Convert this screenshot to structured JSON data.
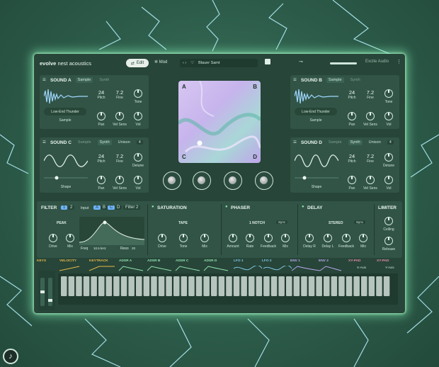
{
  "header": {
    "brand_bold": "evolve",
    "brand_rest": " nest acoustics",
    "edit_label": "Edit",
    "mod_label": "Mod",
    "preset_nav": "‹ ›",
    "preset_name": "Blauer Samt",
    "output_label": "Excite Audio",
    "menu": "⋮"
  },
  "sound_a": {
    "title": "SOUND A",
    "tab1": "Sample",
    "tab2": "Synth",
    "sample_name": "Low-End Thunder",
    "sample_label": "Sample",
    "pitch_val": "24",
    "pitch_label": "Pitch",
    "fine_val": "7.2",
    "fine_label": "Fine",
    "tone_label": "Tone",
    "pan_label": "Pan",
    "velsens_label": "Vel Sens",
    "vol_label": "Vol"
  },
  "sound_b": {
    "title": "SOUND B",
    "tab1": "Sample",
    "tab2": "Synth",
    "sample_name": "Low-End Thunder",
    "sample_label": "Sample",
    "pitch_val": "24",
    "pitch_label": "Pitch",
    "fine_val": "7.2",
    "fine_label": "Fine",
    "tone_label": "Tone",
    "pan_label": "Pan",
    "velsens_label": "Vel Sens",
    "vol_label": "Vol"
  },
  "sound_c": {
    "title": "SOUND C",
    "tab1": "Sample",
    "tab2": "Synth",
    "unison_label": "Unison",
    "unison_val": "4",
    "shape_label": "Shape",
    "pitch_val": "24",
    "pitch_label": "Pitch",
    "fine_val": "7.2",
    "fine_label": "Fine",
    "detune_label": "Detune",
    "pan_label": "Pan",
    "velsens_label": "Vel Sens",
    "vol_label": "Vol"
  },
  "sound_d": {
    "title": "SOUND D",
    "tab1": "Sample",
    "tab2": "Synth",
    "unison_label": "Unison",
    "unison_val": "4",
    "shape_label": "Shape",
    "pitch_val": "24",
    "pitch_label": "Pitch",
    "fine_val": "7.2",
    "fine_label": "Fine",
    "detune_label": "Detune",
    "pan_label": "Pan",
    "velsens_label": "Vel Sens",
    "vol_label": "Vol"
  },
  "xy_pad": {
    "a": "A",
    "b": "B",
    "c": "C",
    "d": "D"
  },
  "fx": {
    "filter": {
      "title": "FILTER",
      "btn1": "1",
      "btn2": "2",
      "input_label": "Input",
      "in_a": "A",
      "in_b": "B",
      "in_c": "C",
      "in_d": "D",
      "filter2": "Filter 2",
      "mode": "PEAK",
      "drive": "Drive",
      "mix": "Mix",
      "freq": "Freq",
      "freq_val": "10.5 kHz",
      "reso": "Reso",
      "reso_val": "20"
    },
    "saturation": {
      "title": "SATURATION",
      "mode": "TAPE",
      "drive": "Drive",
      "tone": "Tone",
      "mix": "Mix"
    },
    "phaser": {
      "title": "PHASER",
      "mode": "1 NOTCH",
      "sync": "Sync",
      "amount": "Amount",
      "rate": "Rate",
      "feedback": "Feedback",
      "mix": "Mix"
    },
    "delay": {
      "title": "DELAY",
      "mode": "STEREO",
      "sync": "Sync",
      "delay_r": "Delay R",
      "delay_l": "Delay L",
      "feedback": "Feedback",
      "mix": "Mix"
    },
    "limiter": {
      "title": "LIMITER",
      "ceiling": "Ceiling",
      "release": "Release"
    }
  },
  "mod_tabs": [
    {
      "label": "KEYS",
      "color": "#e8b84a"
    },
    {
      "label": "VELOCITY",
      "color": "#e8b84a"
    },
    {
      "label": "KEYTRACK",
      "color": "#e8b84a"
    },
    {
      "label": "ADSR A",
      "color": "#8fe0b0"
    },
    {
      "label": "ADSR B",
      "color": "#8fe0b0"
    },
    {
      "label": "ADSR C",
      "color": "#8fe0b0"
    },
    {
      "label": "ADSR D",
      "color": "#8fe0b0"
    },
    {
      "label": "LFO 1",
      "color": "#7ec8e8"
    },
    {
      "label": "LFO 2",
      "color": "#7ec8e8"
    },
    {
      "label": "ENV 1",
      "color": "#b8a8f0"
    },
    {
      "label": "ENV 2",
      "color": "#b8a8f0"
    },
    {
      "label": "XY-PAD",
      "color": "#e88aa8"
    },
    {
      "label": "XY-PAD",
      "color": "#e88aa8"
    }
  ],
  "xy_axes": {
    "x": "X-Axis",
    "y": "Y-Axis"
  },
  "colors": {
    "accent": "#8fe0b0",
    "panel": "#315446",
    "background": "#274538"
  }
}
